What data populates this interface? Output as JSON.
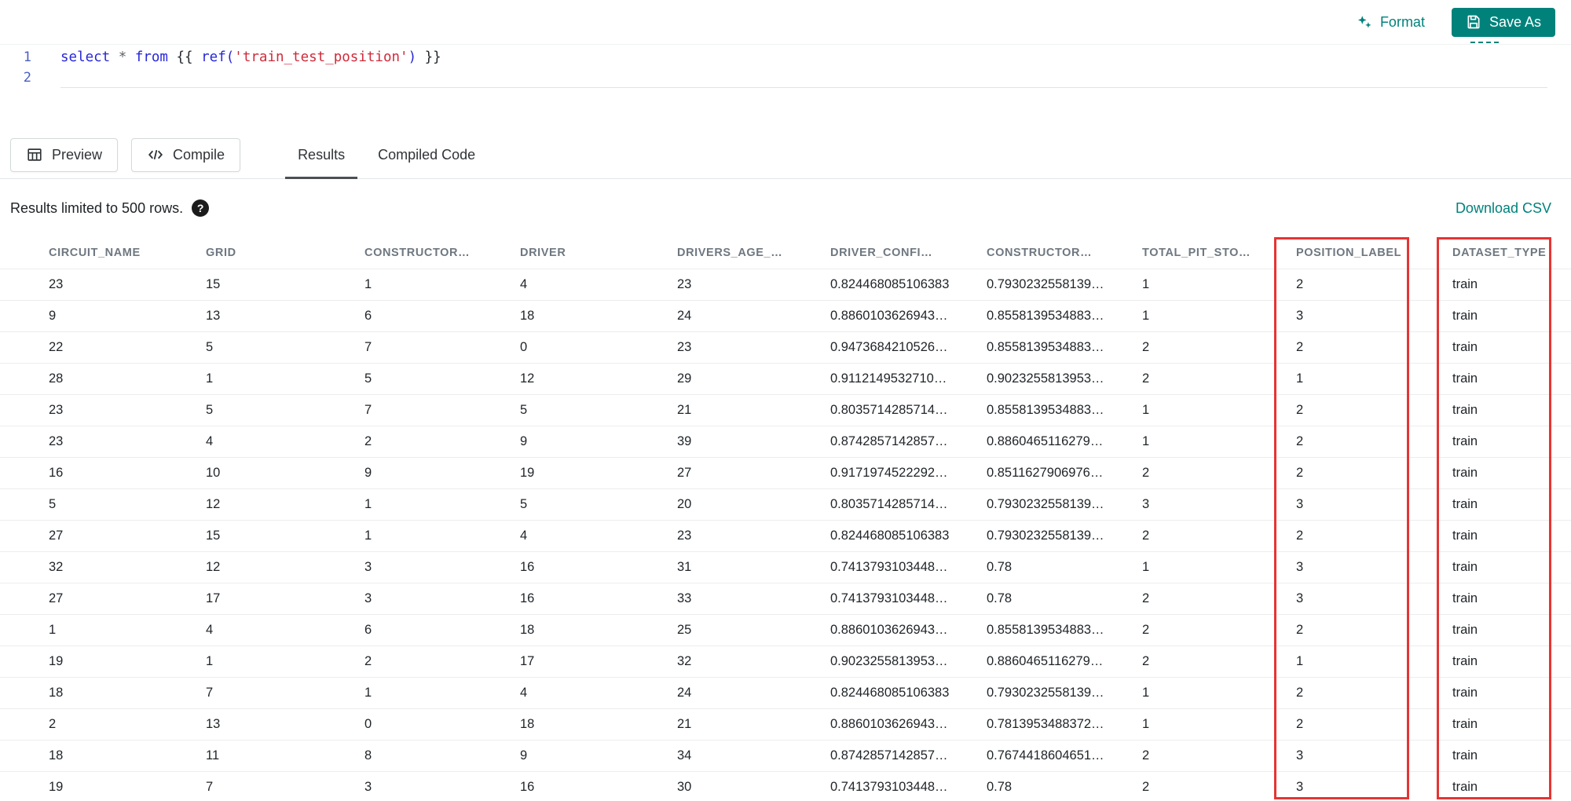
{
  "colors": {
    "accent": "#00827b",
    "highlight_red": "#e63434"
  },
  "topbar": {
    "format_label": "Format",
    "save_as_label": "Save As"
  },
  "editor": {
    "line_numbers": [
      "1",
      "2"
    ],
    "tokens": [
      {
        "type": "kw",
        "text": "select"
      },
      {
        "type": "op",
        "text": " * "
      },
      {
        "type": "kw",
        "text": "from"
      },
      {
        "type": "plain",
        "text": " {{ "
      },
      {
        "type": "fn",
        "text": "ref("
      },
      {
        "type": "str",
        "text": "'train_test_position'"
      },
      {
        "type": "fn",
        "text": ")"
      },
      {
        "type": "plain",
        "text": " }}"
      }
    ]
  },
  "toolbar": {
    "preview_label": "Preview",
    "compile_label": "Compile",
    "tabs": [
      {
        "label": "Results",
        "active": true
      },
      {
        "label": "Compiled Code",
        "active": false
      }
    ]
  },
  "results_bar": {
    "limit_text": "Results limited to 500 rows.",
    "help_glyph": "?",
    "download_label": "Download CSV"
  },
  "table": {
    "columns": [
      "CIRCUIT_NAME",
      "GRID",
      "CONSTRUCTOR…",
      "DRIVER",
      "DRIVERS_AGE_…",
      "DRIVER_CONFI…",
      "CONSTRUCTOR…",
      "TOTAL_PIT_STO…",
      "POSITION_LABEL",
      "DATASET_TYPE"
    ],
    "rows": [
      [
        "23",
        "15",
        "1",
        "4",
        "23",
        "0.824468085106383",
        "0.7930232558139…",
        "1",
        "2",
        "train"
      ],
      [
        "9",
        "13",
        "6",
        "18",
        "24",
        "0.8860103626943…",
        "0.8558139534883…",
        "1",
        "3",
        "train"
      ],
      [
        "22",
        "5",
        "7",
        "0",
        "23",
        "0.9473684210526…",
        "0.8558139534883…",
        "2",
        "2",
        "train"
      ],
      [
        "28",
        "1",
        "5",
        "12",
        "29",
        "0.9112149532710…",
        "0.9023255813953…",
        "2",
        "1",
        "train"
      ],
      [
        "23",
        "5",
        "7",
        "5",
        "21",
        "0.8035714285714…",
        "0.8558139534883…",
        "1",
        "2",
        "train"
      ],
      [
        "23",
        "4",
        "2",
        "9",
        "39",
        "0.8742857142857…",
        "0.8860465116279…",
        "1",
        "2",
        "train"
      ],
      [
        "16",
        "10",
        "9",
        "19",
        "27",
        "0.9171974522292…",
        "0.8511627906976…",
        "2",
        "2",
        "train"
      ],
      [
        "5",
        "12",
        "1",
        "5",
        "20",
        "0.8035714285714…",
        "0.7930232558139…",
        "3",
        "3",
        "train"
      ],
      [
        "27",
        "15",
        "1",
        "4",
        "23",
        "0.824468085106383",
        "0.7930232558139…",
        "2",
        "2",
        "train"
      ],
      [
        "32",
        "12",
        "3",
        "16",
        "31",
        "0.7413793103448…",
        "0.78",
        "1",
        "3",
        "train"
      ],
      [
        "27",
        "17",
        "3",
        "16",
        "33",
        "0.7413793103448…",
        "0.78",
        "2",
        "3",
        "train"
      ],
      [
        "1",
        "4",
        "6",
        "18",
        "25",
        "0.8860103626943…",
        "0.8558139534883…",
        "2",
        "2",
        "train"
      ],
      [
        "19",
        "1",
        "2",
        "17",
        "32",
        "0.9023255813953…",
        "0.8860465116279…",
        "2",
        "1",
        "train"
      ],
      [
        "18",
        "7",
        "1",
        "4",
        "24",
        "0.824468085106383",
        "0.7930232558139…",
        "1",
        "2",
        "train"
      ],
      [
        "2",
        "13",
        "0",
        "18",
        "21",
        "0.8860103626943…",
        "0.7813953488372…",
        "1",
        "2",
        "train"
      ],
      [
        "18",
        "11",
        "8",
        "9",
        "34",
        "0.8742857142857…",
        "0.7674418604651…",
        "2",
        "3",
        "train"
      ],
      [
        "19",
        "7",
        "3",
        "16",
        "30",
        "0.7413793103448…",
        "0.78",
        "2",
        "3",
        "train"
      ]
    ]
  }
}
